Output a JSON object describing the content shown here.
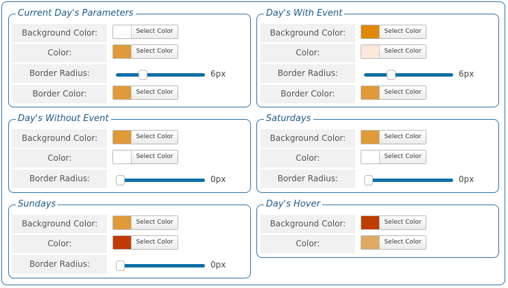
{
  "select_label": "Select Color",
  "groups": {
    "current": {
      "title": "Current Day's Parameters",
      "bg_label": "Background Color:",
      "bg_color": "#ffffff",
      "color_label": "Color:",
      "color_color": "#e09a37",
      "radius_label": "Border Radius:",
      "radius_value": 6,
      "radius_text": "6px",
      "border_label": "Border Color:",
      "border_color": "#e09a37"
    },
    "with_event": {
      "title": "Day's With Event",
      "bg_label": "Background Color:",
      "bg_color": "#de8a08",
      "color_label": "Color:",
      "color_color": "#fde8dc",
      "radius_label": "Border Radius:",
      "radius_value": 6,
      "radius_text": "6px",
      "border_label": "Border Color:",
      "border_color": "#e09a37"
    },
    "without_event": {
      "title": "Day's Without Event",
      "bg_label": "Background Color:",
      "bg_color": "#e09a37",
      "color_label": "Color:",
      "color_color": "#ffffff",
      "radius_label": "Border Radius:",
      "radius_value": 0,
      "radius_text": "0px"
    },
    "saturdays": {
      "title": "Saturdays",
      "bg_label": "Background Color:",
      "bg_color": "#e09a37",
      "color_label": "Color:",
      "color_color": "#ffffff",
      "radius_label": "Border Radius:",
      "radius_value": 0,
      "radius_text": "0px"
    },
    "sundays": {
      "title": "Sundays",
      "bg_label": "Background Color:",
      "bg_color": "#e09a37",
      "color_label": "Color:",
      "color_color": "#bf3c06",
      "radius_label": "Border Radius:",
      "radius_value": 0,
      "radius_text": "0px"
    },
    "hover": {
      "title": "Day's Hover",
      "bg_label": "Background Color:",
      "bg_color": "#bf3c06",
      "color_label": "Color:",
      "color_color": "#deaa64"
    }
  }
}
